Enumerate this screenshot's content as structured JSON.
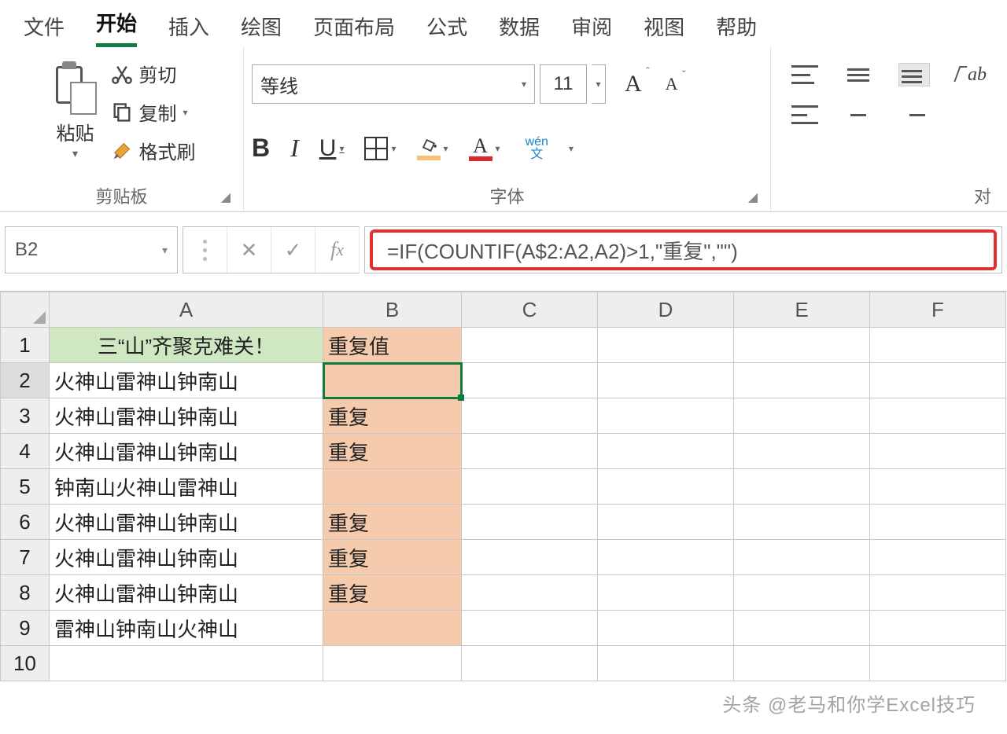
{
  "tabs": {
    "file": "文件",
    "home": "开始",
    "insert": "插入",
    "draw": "绘图",
    "layout": "页面布局",
    "formulas": "公式",
    "data": "数据",
    "review": "审阅",
    "view": "视图",
    "help": "帮助"
  },
  "clipboard": {
    "paste": "粘贴",
    "cut": "剪切",
    "copy": "复制",
    "format_painter": "格式刷",
    "group": "剪贴板"
  },
  "font": {
    "name": "等线",
    "size": "11",
    "group": "字体",
    "wen_top": "wén",
    "wen_bot": "文"
  },
  "align": {
    "group": "对"
  },
  "namebox": "B2",
  "formula": "=IF(COUNTIF(A$2:A2,A2)>1,\"重复\",\"\")",
  "columns": [
    "A",
    "B",
    "C",
    "D",
    "E",
    "F"
  ],
  "rows": [
    {
      "n": "1",
      "a": "三“山”齐聚克难关！",
      "b": "重复值"
    },
    {
      "n": "2",
      "a": "火神山雷神山钟南山",
      "b": ""
    },
    {
      "n": "3",
      "a": "火神山雷神山钟南山",
      "b": "重复"
    },
    {
      "n": "4",
      "a": "火神山雷神山钟南山",
      "b": "重复"
    },
    {
      "n": "5",
      "a": "钟南山火神山雷神山",
      "b": ""
    },
    {
      "n": "6",
      "a": "火神山雷神山钟南山",
      "b": "重复"
    },
    {
      "n": "7",
      "a": "火神山雷神山钟南山",
      "b": "重复"
    },
    {
      "n": "8",
      "a": "火神山雷神山钟南山",
      "b": "重复"
    },
    {
      "n": "9",
      "a": "雷神山钟南山火神山",
      "b": ""
    },
    {
      "n": "10",
      "a": "",
      "b": ""
    }
  ],
  "watermark": "头条 @老马和你学Excel技巧"
}
